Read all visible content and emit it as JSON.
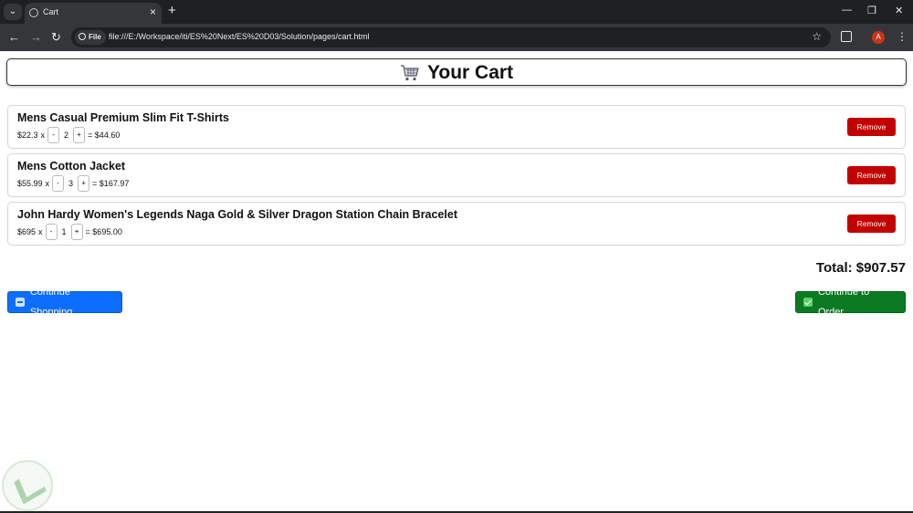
{
  "browser": {
    "tab_title": "Cart",
    "tab_close": "×",
    "new_tab": "+",
    "url_chip": "File",
    "url": "file:///E:/Workspace/iti/ES%20Next/ES%20D03/Solution/pages/cart.html",
    "profile_initial": "A",
    "icons": [
      "tab-search-icon",
      "globe-icon",
      "back-icon",
      "forward-icon",
      "reload-icon",
      "info-icon",
      "star-icon",
      "extensions-icon",
      "kebab-menu-icon",
      "minimize-icon",
      "restore-icon",
      "window-close-icon"
    ]
  },
  "header": {
    "title": "Your Cart",
    "icon": "shopping-cart-icon"
  },
  "items": [
    {
      "name": "Mens Casual Premium Slim Fit T-Shirts",
      "price": "$22.3",
      "qty": "2",
      "subtotal": "= $44.60",
      "remove": "Remove"
    },
    {
      "name": "Mens Cotton Jacket",
      "price": "$55.99",
      "qty": "3",
      "subtotal": "= $167.97",
      "remove": "Remove"
    },
    {
      "name": "John Hardy Women's Legends Naga Gold & Silver Dragon Station Chain Bracelet",
      "price": "$695",
      "qty": "1",
      "subtotal": "= $695.00",
      "remove": "Remove"
    }
  ],
  "labels": {
    "times": "x",
    "minus": "-",
    "plus": "+"
  },
  "total": "Total: $907.57",
  "actions": {
    "continue_shopping": "Continue Shopping",
    "continue_order": "Continue to Order"
  },
  "colors": {
    "remove": "#c30000",
    "primary": "#0d6efd",
    "success": "#0b7a23"
  }
}
